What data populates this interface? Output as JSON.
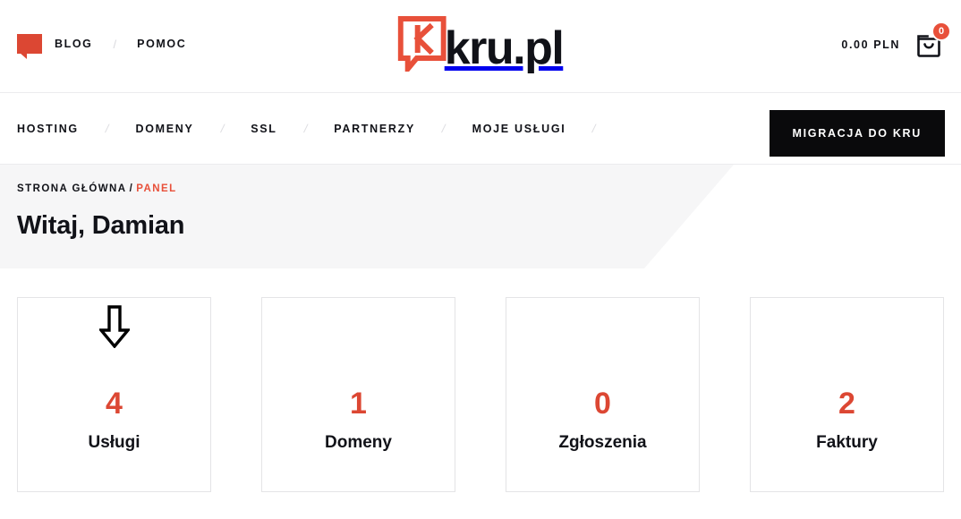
{
  "brand": {
    "mark_icon": "kru-k-bubble-logo-icon",
    "wordmark": "kru.pl",
    "accent_color": "#DC4733",
    "text_color": "#111218"
  },
  "topbar": {
    "bubble_icon": "speech-bubble-icon",
    "links": [
      {
        "label": "BLOG"
      },
      {
        "label": "POMOC"
      }
    ],
    "separator": "/",
    "cart": {
      "price": "0.00 PLN",
      "icon": "shopping-bag-icon",
      "badge_count": "0",
      "badge_color": "#E8503A"
    }
  },
  "mainnav": {
    "items": [
      {
        "label": "HOSTING"
      },
      {
        "label": "DOMENY"
      },
      {
        "label": "SSL"
      },
      {
        "label": "PARTNERZY"
      },
      {
        "label": "MOJE USŁUGI"
      }
    ],
    "separator": "/",
    "cta": {
      "label": "MIGRACJA DO KRU",
      "background": "#0a0a0c",
      "color": "#ffffff"
    }
  },
  "banner": {
    "breadcrumb": {
      "home": "STRONA GŁÓWNA",
      "slash": "/",
      "current": "PANEL",
      "current_color": "#E8503A"
    },
    "title": "Witaj, Damian",
    "background": "#F6F6F7"
  },
  "cards": [
    {
      "value": "4",
      "label": "Usługi",
      "has_cursor": true
    },
    {
      "value": "1",
      "label": "Domeny",
      "has_cursor": false
    },
    {
      "value": "0",
      "label": "Zgłoszenia",
      "has_cursor": false
    },
    {
      "value": "2",
      "label": "Faktury",
      "has_cursor": false
    }
  ],
  "cursor": {
    "icon": "down-arrow-cursor-icon"
  }
}
